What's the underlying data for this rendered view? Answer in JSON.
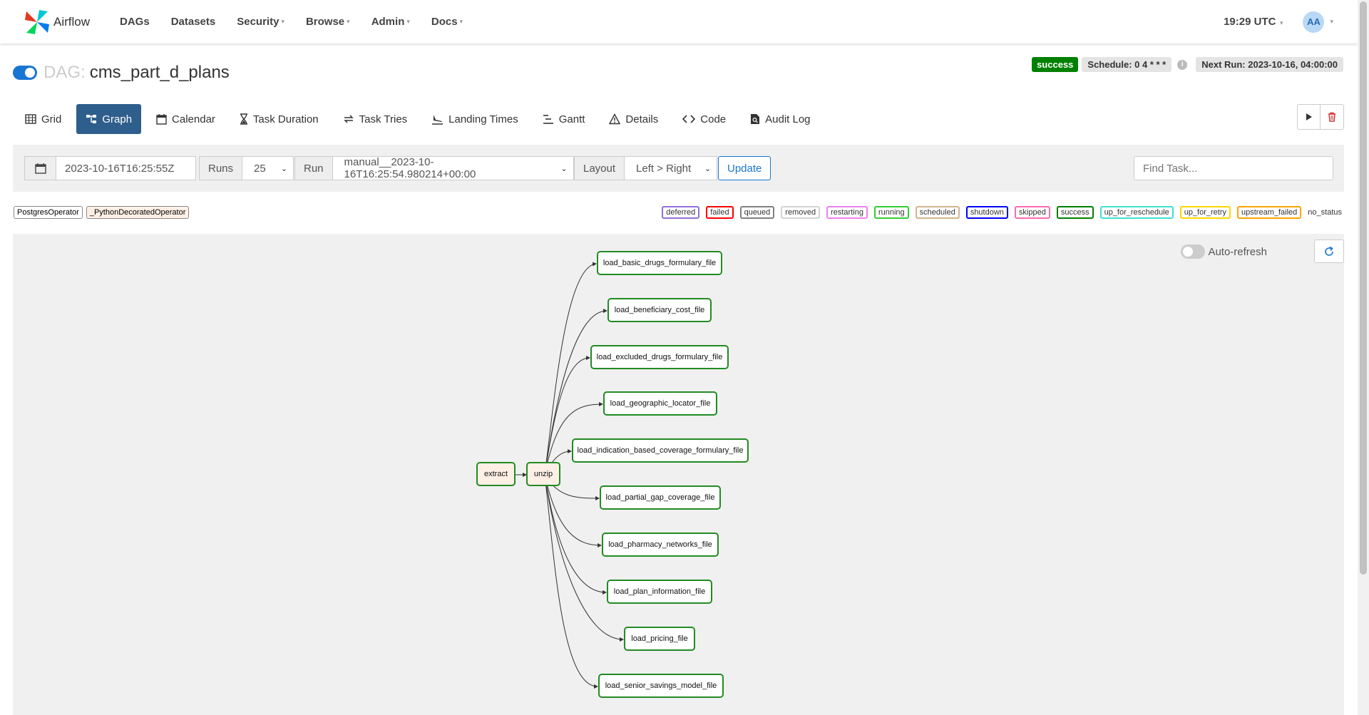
{
  "navbar": {
    "brand": "Airflow",
    "items": [
      {
        "label": "DAGs",
        "dropdown": false
      },
      {
        "label": "Datasets",
        "dropdown": false
      },
      {
        "label": "Security",
        "dropdown": true
      },
      {
        "label": "Browse",
        "dropdown": true
      },
      {
        "label": "Admin",
        "dropdown": true
      },
      {
        "label": "Docs",
        "dropdown": true
      }
    ],
    "clock": "19:29 UTC",
    "user_initials": "AA"
  },
  "header": {
    "dag_label": "DAG:",
    "dag_id": "cms_part_d_plans",
    "status": "success",
    "schedule": "Schedule: 0 4 * * *",
    "next_run": "Next Run: 2023-10-16, 04:00:00"
  },
  "tabs": [
    {
      "label": "Grid",
      "icon": "grid-icon"
    },
    {
      "label": "Graph",
      "icon": "graph-icon",
      "active": true
    },
    {
      "label": "Calendar",
      "icon": "calendar-icon"
    },
    {
      "label": "Task Duration",
      "icon": "hourglass-icon"
    },
    {
      "label": "Task Tries",
      "icon": "retry-icon"
    },
    {
      "label": "Landing Times",
      "icon": "plane-landing-icon"
    },
    {
      "label": "Gantt",
      "icon": "gantt-icon"
    },
    {
      "label": "Details",
      "icon": "warning-triangle-icon"
    },
    {
      "label": "Code",
      "icon": "code-icon"
    },
    {
      "label": "Audit Log",
      "icon": "file-search-icon"
    }
  ],
  "filters": {
    "base_date": "2023-10-16T16:25:55Z",
    "runs_label": "Runs",
    "runs_value": "25",
    "run_label": "Run",
    "run_value": "manual__2023-10-16T16:25:54.980214+00:00",
    "layout_label": "Layout",
    "layout_value": "Left > Right",
    "update_label": "Update",
    "find_placeholder": "Find Task..."
  },
  "operators": [
    "PostgresOperator",
    "_PythonDecoratedOperator"
  ],
  "states": [
    {
      "label": "deferred",
      "color": "#9370db"
    },
    {
      "label": "failed",
      "color": "#ff0000"
    },
    {
      "label": "queued",
      "color": "#808080"
    },
    {
      "label": "removed",
      "color": "#d3d3d3"
    },
    {
      "label": "restarting",
      "color": "#ee82ee"
    },
    {
      "label": "running",
      "color": "#32cd32"
    },
    {
      "label": "scheduled",
      "color": "#d2b48c"
    },
    {
      "label": "shutdown",
      "color": "#0000ff"
    },
    {
      "label": "skipped",
      "color": "#ff69b4"
    },
    {
      "label": "success",
      "color": "#008000"
    },
    {
      "label": "up_for_reschedule",
      "color": "#40e0d0"
    },
    {
      "label": "up_for_retry",
      "color": "#ffd700"
    },
    {
      "label": "upstream_failed",
      "color": "#ffa500"
    },
    {
      "label": "no_status",
      "color": ""
    }
  ],
  "graph": {
    "autorefresh_label": "Auto-refresh",
    "extract": "extract",
    "unzip": "unzip",
    "tasks": [
      "load_basic_drugs_formulary_file",
      "load_beneficiary_cost_file",
      "load_excluded_drugs_formulary_file",
      "load_geographic_locator_file",
      "load_indication_based_coverage_formulary_file",
      "load_partial_gap_coverage_file",
      "load_pharmacy_networks_file",
      "load_plan_information_file",
      "load_pricing_file",
      "load_senior_savings_model_file"
    ]
  }
}
